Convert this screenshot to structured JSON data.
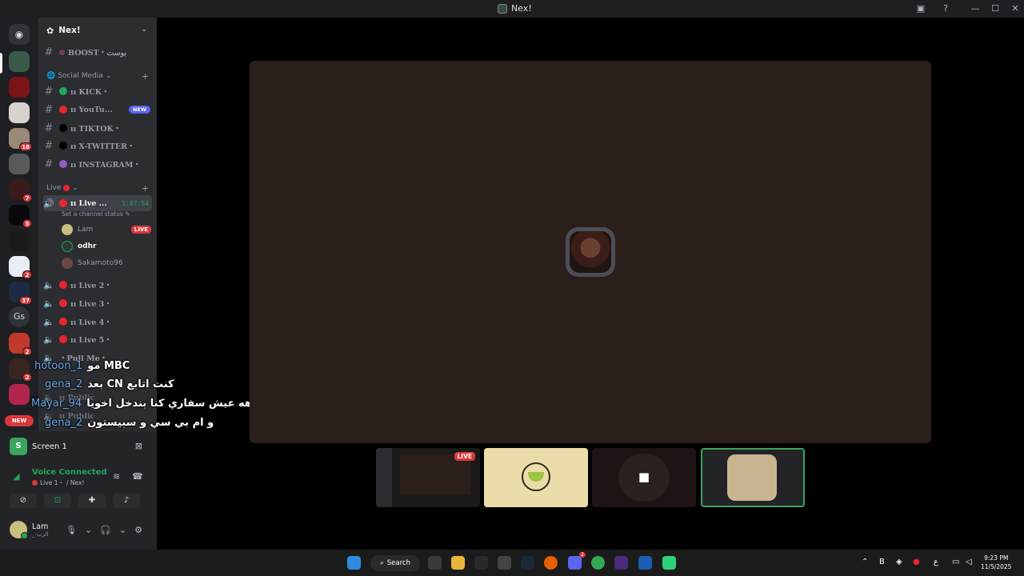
{
  "window": {
    "title": "Nex!"
  },
  "rail": {
    "badges": [
      "16",
      "7",
      "5",
      "2",
      "37",
      "2",
      "2"
    ],
    "gs_label": "Gs",
    "new_label": "NEW"
  },
  "guild": {
    "name": "Nex!",
    "channels_top": [
      {
        "name": "BOOST・بوست"
      }
    ],
    "categories": [
      {
        "label": "Social Media"
      },
      {
        "label": "Live"
      }
    ],
    "social": [
      {
        "name": "ıı KICK・",
        "color": "#23a55a"
      },
      {
        "name": "ıı YouTu...",
        "color": "#e8262e",
        "tag": "NEW"
      },
      {
        "name": "ıı TIKTOK・",
        "color": "#000000"
      },
      {
        "name": "ıı X-TWITTER・",
        "color": "#000000"
      },
      {
        "name": "ıı INSTAGRAM・",
        "color": "#8e5ec9"
      }
    ],
    "live_active": {
      "name": "ıı Live ...",
      "timer": "1:07:54",
      "status": "Set a channel status"
    },
    "members": [
      {
        "name": "Lam",
        "tag": "LIVE"
      },
      {
        "name": "odhr"
      },
      {
        "name": "Sakamoto96"
      }
    ],
    "live_channels": [
      {
        "name": "ıı Live 2・"
      },
      {
        "name": "ıı Live 3・"
      },
      {
        "name": "ıı Live 4・"
      },
      {
        "name": "ıı Live 5・"
      }
    ],
    "pull_me": "・Pull Me・",
    "public_1": "ıı Public",
    "public_2": "ıı Public"
  },
  "chat": [
    {
      "user": "hotoon_1",
      "msg": "مو MBC"
    },
    {
      "user": "gena_2",
      "msg": "بعد CN كنت اتابع"
    },
    {
      "user": "Mayar_94",
      "msg": "يوهه عيش سفاري كنا بندخل اخويا"
    },
    {
      "user": "gena_2",
      "msg": "و ام بي سي و سبيستون"
    }
  ],
  "voice": {
    "screen_label": "Screen 1",
    "connected": "Voice Connected",
    "channel": "Live 1・",
    "server": "/ Nex!",
    "user_name": "Lam",
    "user_sub": "_ الرب"
  },
  "stage": {
    "thumb_live_label": "LIVE"
  },
  "taskbar": {
    "search_label": "Search",
    "time": "9:23 PM",
    "date": "11/5/2025",
    "lang": "ع",
    "discord_badge": "2"
  }
}
